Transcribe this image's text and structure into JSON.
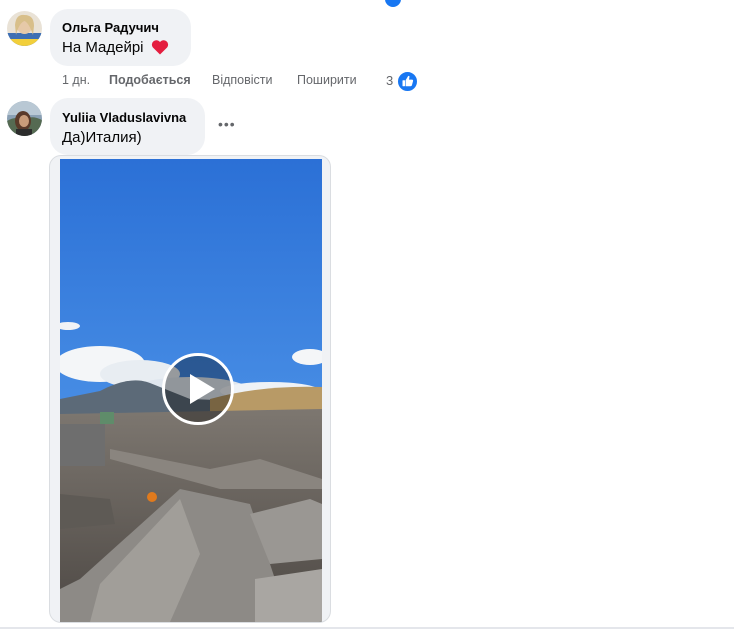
{
  "comments": [
    {
      "author": "Ольга Радучич",
      "text": "На Мадейрі",
      "emoji": "heart",
      "time": "1 дн.",
      "like_label": "Подобається",
      "reply_label": "Відповісти",
      "share_label": "Поширити",
      "reaction_count": "3",
      "reaction_icon": "like-icon"
    },
    {
      "author": "Yuliia Vladuslavivna",
      "text": "Да)Италия)",
      "attachment": "video"
    }
  ],
  "colors": {
    "accent": "#1877f2",
    "bubble": "#f0f2f5",
    "muted_text": "#65676b",
    "heart": "#e41e3f"
  }
}
